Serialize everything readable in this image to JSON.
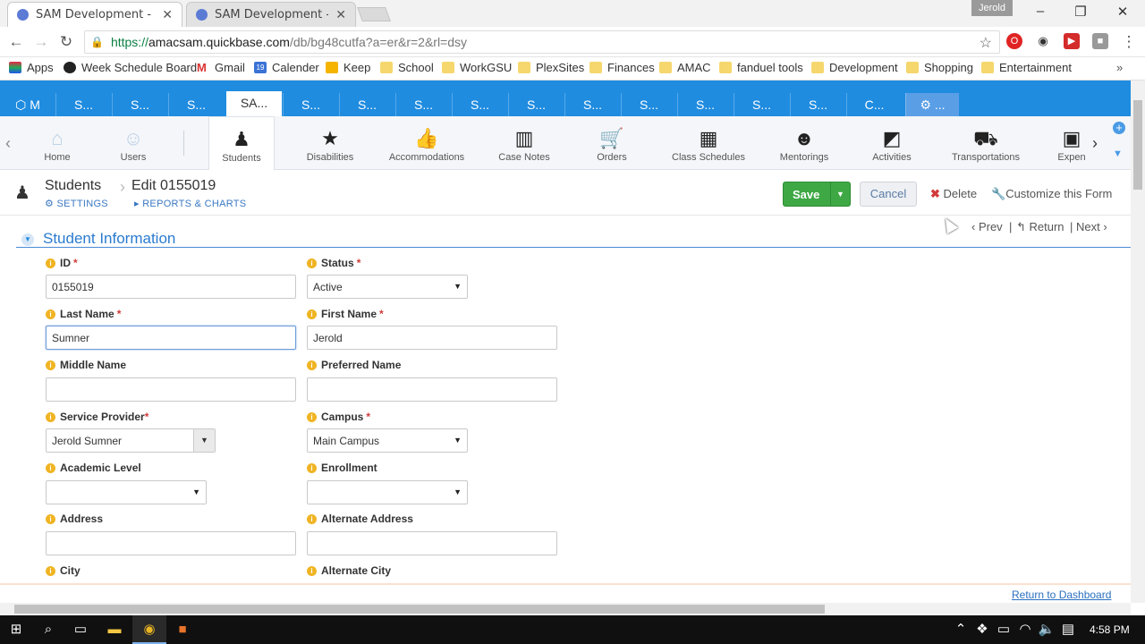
{
  "browser": {
    "tabs": [
      {
        "title": "SAM Development - Edit",
        "active": true
      },
      {
        "title": "SAM Development - Fiel",
        "active": false
      }
    ],
    "user": "Jerold",
    "url": {
      "scheme": "https://",
      "host": "amacsam.quickbase.com",
      "path": "/db/bg48cutfa?a=er&r=2&rl=dsy"
    },
    "bookmarks": [
      "Apps",
      "Week Schedule Board",
      "Gmail",
      "Calender",
      "Keep",
      "School",
      "WorkGSU",
      "PlexSites",
      "Finances",
      "AMAC",
      "fanduel tools",
      "Development",
      "Shopping",
      "Entertainment"
    ],
    "bookmarks_more": "»"
  },
  "app": {
    "tabs": [
      "M",
      "S...",
      "S...",
      "S...",
      "SA...",
      "S...",
      "S...",
      "S...",
      "S...",
      "S...",
      "S...",
      "S...",
      "S...",
      "S...",
      "S...",
      "C...",
      "..."
    ],
    "nav": [
      {
        "label": "Home",
        "icon": "home-icon"
      },
      {
        "label": "Users",
        "icon": "user-icon"
      },
      {
        "label": "Students",
        "icon": "graduate-icon"
      },
      {
        "label": "Disabilities",
        "icon": "star-icon"
      },
      {
        "label": "Accommodations",
        "icon": "thumbs-up-icon"
      },
      {
        "label": "Case Notes",
        "icon": "columns-icon"
      },
      {
        "label": "Orders",
        "icon": "cart-icon"
      },
      {
        "label": "Class Schedules",
        "icon": "calendar-grid-icon"
      },
      {
        "label": "Mentorings",
        "icon": "smiley-icon"
      },
      {
        "label": "Activities",
        "icon": "presentation-icon"
      },
      {
        "label": "Transportations",
        "icon": "truck-icon"
      },
      {
        "label": "Expen",
        "icon": "badge-icon"
      }
    ],
    "header": {
      "table": "Students",
      "record": "Edit 0155019",
      "settings": "SETTINGS",
      "reports": "REPORTS & CHARTS",
      "save": "Save",
      "cancel": "Cancel",
      "delete": "Delete",
      "customize": "Customize this Form",
      "prev": "Prev",
      "return": "Return",
      "next": "Next",
      "sep": "|"
    },
    "section_title": "Student Information",
    "fields": {
      "id": {
        "label": "ID",
        "value": "0155019"
      },
      "status": {
        "label": "Status",
        "value": "Active"
      },
      "last_name": {
        "label": "Last Name",
        "value": "Sumner"
      },
      "first_name": {
        "label": "First Name",
        "value": "Jerold"
      },
      "middle_name": {
        "label": "Middle Name",
        "value": ""
      },
      "preferred_name": {
        "label": "Preferred Name",
        "value": ""
      },
      "service_provider": {
        "label": "Service Provider",
        "value": "Jerold Sumner"
      },
      "campus": {
        "label": "Campus",
        "value": "Main Campus"
      },
      "academic_level": {
        "label": "Academic Level",
        "value": ""
      },
      "enrollment": {
        "label": "Enrollment",
        "value": ""
      },
      "address": {
        "label": "Address",
        "value": ""
      },
      "alternate_address": {
        "label": "Alternate Address",
        "value": ""
      },
      "city": {
        "label": "City"
      },
      "alternate_city": {
        "label": "Alternate City"
      }
    },
    "return_dashboard": "Return to Dashboard",
    "required_mark": "*"
  },
  "taskbar": {
    "time": "4:58 PM"
  },
  "colors": {
    "brand_blue": "#1f8ce0",
    "save_green": "#3ea845",
    "required_red": "#d23a3a",
    "info_orange": "#f0b423"
  }
}
